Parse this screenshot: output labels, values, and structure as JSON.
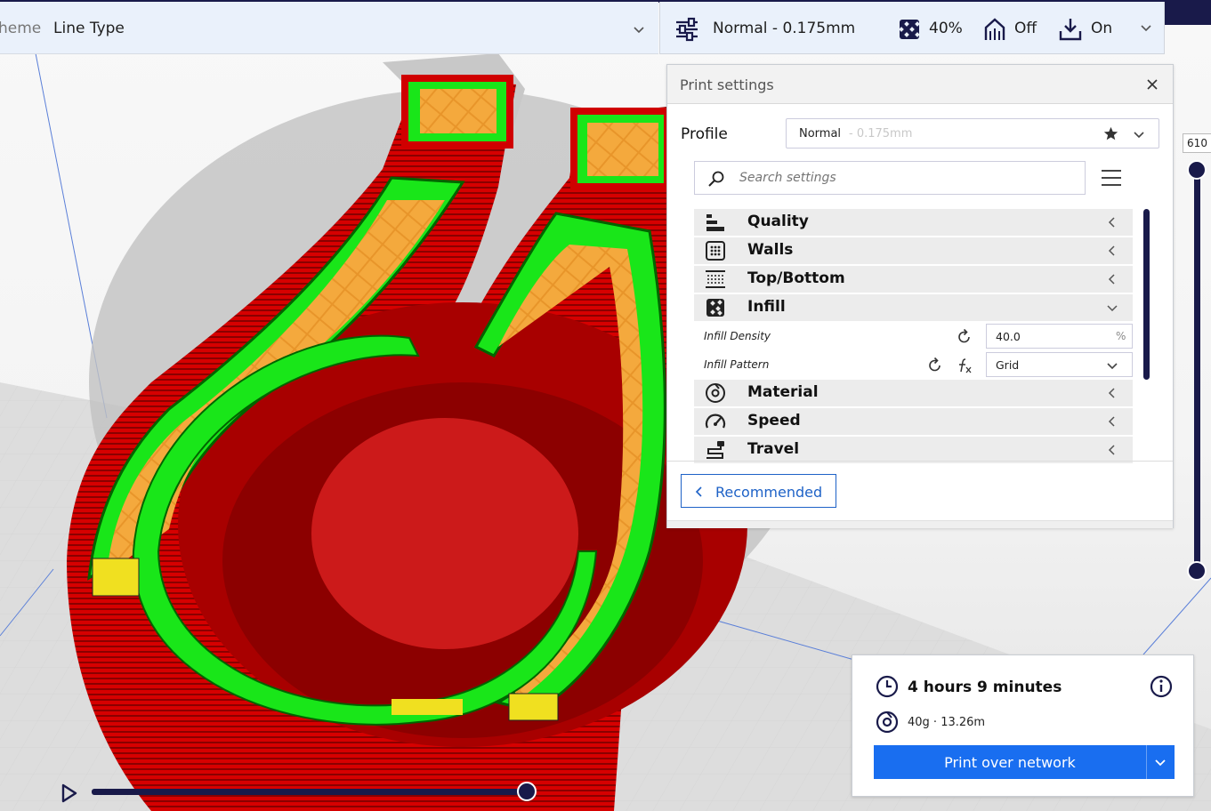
{
  "colors": {
    "accent": "#191a4a",
    "primary_button": "#196ef0",
    "wall_outer": "#e00000",
    "wall_inner": "#19e619",
    "infill": "#f0a030",
    "top_bottom": "#f0e020"
  },
  "topbar": {
    "color_scheme_label_partial": "heme",
    "color_scheme_value": "Line Type",
    "profile_summary": "Normal - 0.175mm",
    "infill_value": "40%",
    "support_value": "Off",
    "adhesion_value": "On"
  },
  "print_settings": {
    "title": "Print settings",
    "profile_label": "Profile",
    "profile_name": "Normal",
    "profile_sub": " - 0.175mm",
    "search_placeholder": "Search settings",
    "categories": [
      {
        "label": "Quality",
        "icon": "quality-icon",
        "expanded": false
      },
      {
        "label": "Walls",
        "icon": "walls-icon",
        "expanded": false
      },
      {
        "label": "Top/Bottom",
        "icon": "top-bottom-icon",
        "expanded": false
      },
      {
        "label": "Infill",
        "icon": "infill-icon",
        "expanded": true
      },
      {
        "label": "Material",
        "icon": "material-icon",
        "expanded": false
      },
      {
        "label": "Speed",
        "icon": "speed-icon",
        "expanded": false
      },
      {
        "label": "Travel",
        "icon": "travel-icon",
        "expanded": false
      }
    ],
    "infill_settings": {
      "density_label": "Infill Density",
      "density_value": "40.0",
      "density_unit": "%",
      "pattern_label": "Infill Pattern",
      "pattern_value": "Grid"
    },
    "recommended_label": "Recommended"
  },
  "layer_slider": {
    "current_layer": "610"
  },
  "job": {
    "time": "4 hours 9 minutes",
    "material": "40g · 13.26m",
    "print_button": "Print over network"
  }
}
